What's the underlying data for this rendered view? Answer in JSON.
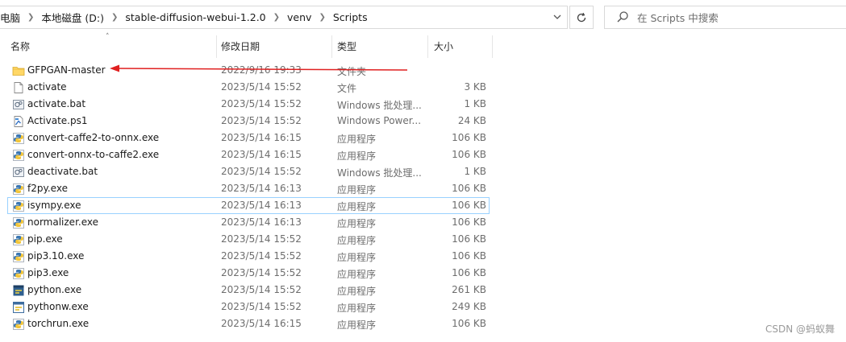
{
  "breadcrumb": [
    "电脑",
    "本地磁盘 (D:)",
    "stable-diffusion-webui-1.2.0",
    "venv",
    "Scripts"
  ],
  "search": {
    "placeholder": "在 Scripts 中搜索"
  },
  "columns": {
    "name": "名称",
    "date": "修改日期",
    "type": "类型",
    "size": "大小"
  },
  "files": [
    {
      "name": "GFPGAN-master",
      "date": "2022/9/16 19:33",
      "type": "文件夹",
      "size": "",
      "icon": "folder-icon"
    },
    {
      "name": "activate",
      "date": "2023/5/14 15:52",
      "type": "文件",
      "size": "3 KB",
      "icon": "file-icon"
    },
    {
      "name": "activate.bat",
      "date": "2023/5/14 15:52",
      "type": "Windows 批处理...",
      "size": "1 KB",
      "icon": "batch-file-icon"
    },
    {
      "name": "Activate.ps1",
      "date": "2023/5/14 15:52",
      "type": "Windows Power...",
      "size": "24 KB",
      "icon": "powershell-script-icon"
    },
    {
      "name": "convert-caffe2-to-onnx.exe",
      "date": "2023/5/14 16:15",
      "type": "应用程序",
      "size": "106 KB",
      "icon": "python-exe-icon"
    },
    {
      "name": "convert-onnx-to-caffe2.exe",
      "date": "2023/5/14 16:15",
      "type": "应用程序",
      "size": "106 KB",
      "icon": "python-exe-icon"
    },
    {
      "name": "deactivate.bat",
      "date": "2023/5/14 15:52",
      "type": "Windows 批处理...",
      "size": "1 KB",
      "icon": "batch-file-icon"
    },
    {
      "name": "f2py.exe",
      "date": "2023/5/14 16:13",
      "type": "应用程序",
      "size": "106 KB",
      "icon": "python-exe-icon"
    },
    {
      "name": "isympy.exe",
      "date": "2023/5/14 16:13",
      "type": "应用程序",
      "size": "106 KB",
      "icon": "python-exe-icon"
    },
    {
      "name": "normalizer.exe",
      "date": "2023/5/14 16:13",
      "type": "应用程序",
      "size": "106 KB",
      "icon": "python-exe-icon"
    },
    {
      "name": "pip.exe",
      "date": "2023/5/14 15:52",
      "type": "应用程序",
      "size": "106 KB",
      "icon": "python-exe-icon"
    },
    {
      "name": "pip3.10.exe",
      "date": "2023/5/14 15:52",
      "type": "应用程序",
      "size": "106 KB",
      "icon": "python-exe-icon"
    },
    {
      "name": "pip3.exe",
      "date": "2023/5/14 15:52",
      "type": "应用程序",
      "size": "106 KB",
      "icon": "python-exe-icon"
    },
    {
      "name": "python.exe",
      "date": "2023/5/14 15:52",
      "type": "应用程序",
      "size": "261 KB",
      "icon": "python-app-icon"
    },
    {
      "name": "pythonw.exe",
      "date": "2023/5/14 15:52",
      "type": "应用程序",
      "size": "249 KB",
      "icon": "pythonw-app-icon"
    },
    {
      "name": "torchrun.exe",
      "date": "2023/5/14 16:15",
      "type": "应用程序",
      "size": "106 KB",
      "icon": "python-exe-icon"
    }
  ],
  "focused_row": 8,
  "annotation": {
    "color": "#e02020"
  },
  "watermark": "CSDN @蚂蚁舞"
}
